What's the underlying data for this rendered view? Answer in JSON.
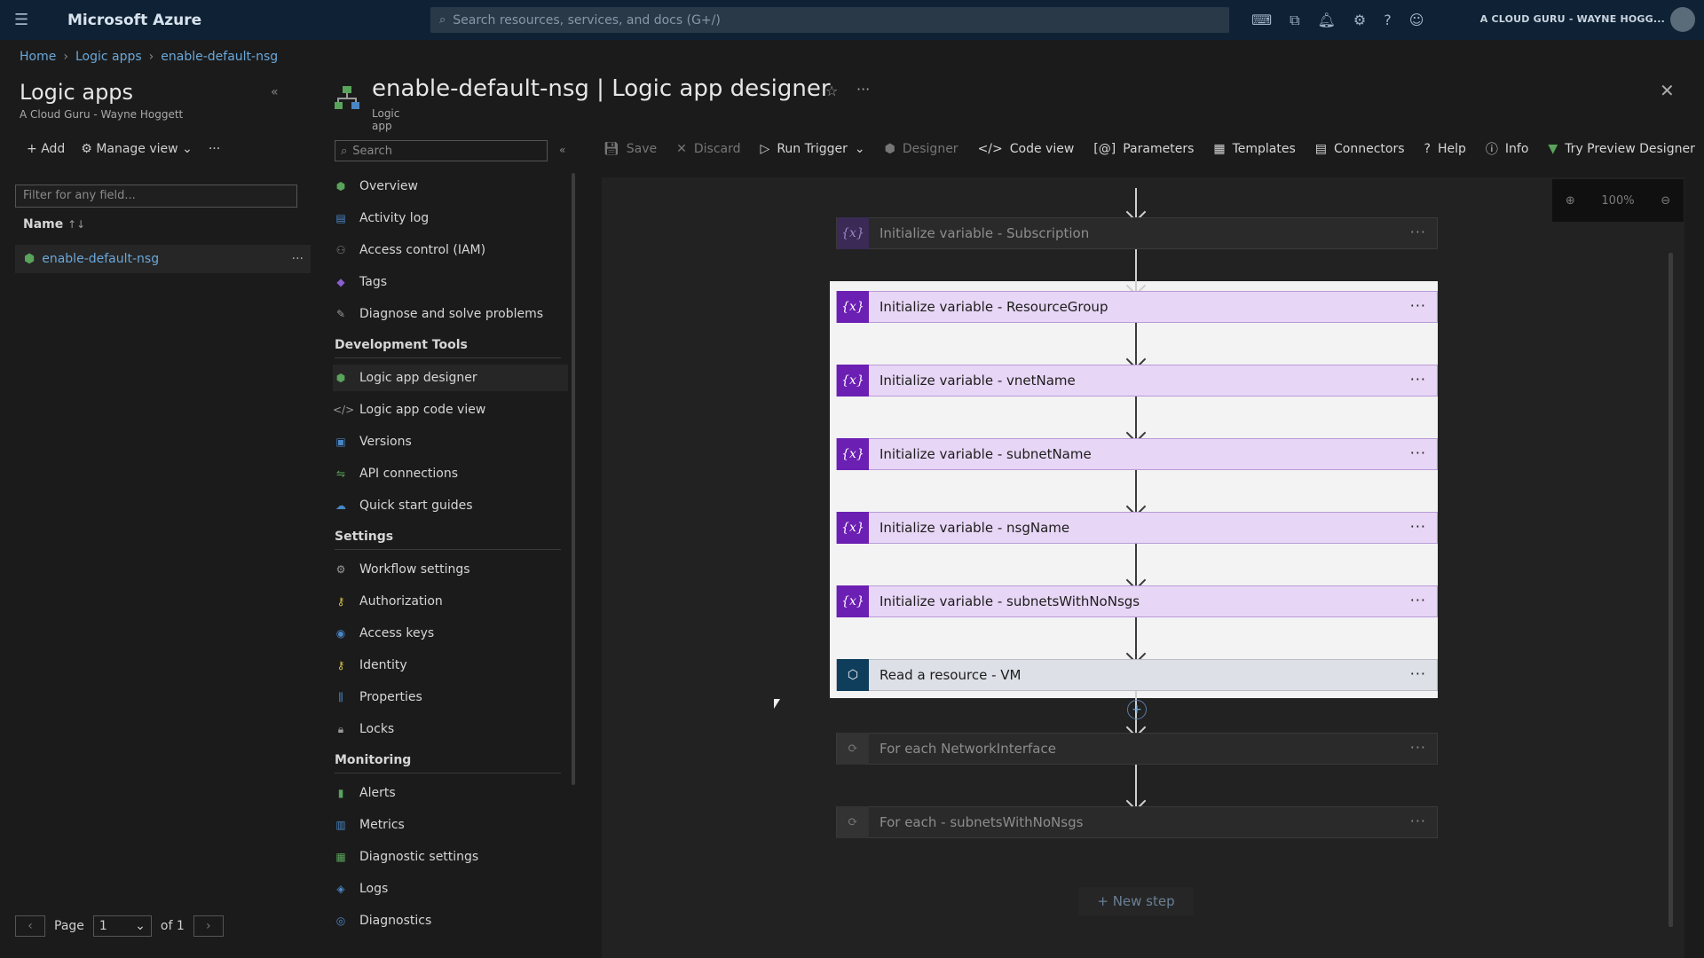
{
  "portal": {
    "menu_icon": "hamburger-icon",
    "brand": "Microsoft Azure",
    "search_placeholder": "Search resources, services, and docs (G+/)",
    "account": "A CLOUD GURU - WAYNE HOGG..."
  },
  "breadcrumb": [
    "Home",
    "Logic apps",
    "enable-default-nsg"
  ],
  "left_pane": {
    "title": "Logic apps",
    "subtitle": "A Cloud Guru - Wayne Hoggett",
    "add_label": "Add",
    "manage_view_label": "Manage view",
    "filter_placeholder": "Filter for any field...",
    "column_name": "Name",
    "sort_indicator": "↑↓",
    "rows": [
      {
        "name": "enable-default-nsg"
      }
    ],
    "pager": {
      "page_label": "Page",
      "page_value": "1",
      "of_label": "of 1"
    }
  },
  "resource": {
    "title": "enable-default-nsg | Logic app designer",
    "subtitle": "Logic app"
  },
  "nav": {
    "search_placeholder": "Search",
    "items_top": [
      {
        "label": "Overview",
        "icon": "overview-icon",
        "glyph": "⬢",
        "color": "#59a35b"
      },
      {
        "label": "Activity log",
        "icon": "activity-log-icon",
        "glyph": "▤",
        "color": "#4a86c5"
      },
      {
        "label": "Access control (IAM)",
        "icon": "iam-icon",
        "glyph": "⚇",
        "color": "#8a8a8a"
      },
      {
        "label": "Tags",
        "icon": "tag-icon",
        "glyph": "◆",
        "color": "#8a5fd1"
      },
      {
        "label": "Diagnose and solve problems",
        "icon": "wrench-icon",
        "glyph": "✎",
        "color": "#9a9a9a"
      }
    ],
    "section_dev": "Development Tools",
    "items_dev": [
      {
        "label": "Logic app designer",
        "icon": "designer-icon",
        "glyph": "⬢",
        "color": "#59a35b"
      },
      {
        "label": "Logic app code view",
        "icon": "code-view-icon",
        "glyph": "</>",
        "color": "#9a9a9a"
      },
      {
        "label": "Versions",
        "icon": "versions-icon",
        "glyph": "▣",
        "color": "#4a86c5"
      },
      {
        "label": "API connections",
        "icon": "api-connections-icon",
        "glyph": "⇋",
        "color": "#59a35b"
      },
      {
        "label": "Quick start guides",
        "icon": "quickstart-icon",
        "glyph": "☁",
        "color": "#4a86c5"
      }
    ],
    "section_settings": "Settings",
    "items_settings": [
      {
        "label": "Workflow settings",
        "icon": "gear-icon",
        "glyph": "⚙",
        "color": "#9a9a9a"
      },
      {
        "label": "Authorization",
        "icon": "key-icon",
        "glyph": "⚷",
        "color": "#d8c24a"
      },
      {
        "label": "Access keys",
        "icon": "access-keys-icon",
        "glyph": "◉",
        "color": "#4a86c5"
      },
      {
        "label": "Identity",
        "icon": "identity-icon",
        "glyph": "⚷",
        "color": "#d8c24a"
      },
      {
        "label": "Properties",
        "icon": "properties-icon",
        "glyph": "⫼",
        "color": "#4a86c5"
      },
      {
        "label": "Locks",
        "icon": "lock-icon",
        "glyph": "🔒︎",
        "color": "#9a9a9a"
      }
    ],
    "section_monitoring": "Monitoring",
    "items_monitoring": [
      {
        "label": "Alerts",
        "icon": "alerts-icon",
        "glyph": "▮",
        "color": "#59a35b"
      },
      {
        "label": "Metrics",
        "icon": "metrics-icon",
        "glyph": "▥",
        "color": "#4a86c5"
      },
      {
        "label": "Diagnostic settings",
        "icon": "diagnostic-settings-icon",
        "glyph": "▦",
        "color": "#59a35b"
      },
      {
        "label": "Logs",
        "icon": "logs-icon",
        "glyph": "◈",
        "color": "#4a86c5"
      },
      {
        "label": "Diagnostics",
        "icon": "diagnostics-icon",
        "glyph": "◎",
        "color": "#4a86c5"
      }
    ]
  },
  "toolbar": [
    {
      "label": "Save",
      "icon": "save-icon",
      "glyph": "💾︎",
      "enabled": false
    },
    {
      "label": "Discard",
      "icon": "discard-icon",
      "glyph": "✕",
      "enabled": false
    },
    {
      "label": "Run Trigger",
      "icon": "run-trigger-icon",
      "glyph": "▷",
      "enabled": true,
      "dropdown": true
    },
    {
      "label": "Designer",
      "icon": "designer-icon",
      "glyph": "⬢",
      "enabled": false
    },
    {
      "label": "Code view",
      "icon": "code-view-icon",
      "glyph": "</>",
      "enabled": true
    },
    {
      "label": "Parameters",
      "icon": "parameters-icon",
      "glyph": "[@]",
      "enabled": true
    },
    {
      "label": "Templates",
      "icon": "templates-icon",
      "glyph": "▦",
      "enabled": true
    },
    {
      "label": "Connectors",
      "icon": "connectors-icon",
      "glyph": "▤",
      "enabled": true
    },
    {
      "label": "Help",
      "icon": "help-icon",
      "glyph": "?",
      "enabled": true
    },
    {
      "label": "Info",
      "icon": "info-icon",
      "glyph": "ⓘ",
      "enabled": true
    },
    {
      "label": "Try Preview Designer",
      "icon": "preview-icon",
      "glyph": "▼",
      "enabled": true
    }
  ],
  "zoom": {
    "level": "100%"
  },
  "steps": [
    {
      "label": "Initialize variable - Subscription",
      "kind": "variable",
      "highlighted": false
    },
    {
      "label": "Initialize variable - ResourceGroup",
      "kind": "variable",
      "highlighted": true
    },
    {
      "label": "Initialize variable - vnetName",
      "kind": "variable",
      "highlighted": true
    },
    {
      "label": "Initialize variable - subnetName",
      "kind": "variable",
      "highlighted": true
    },
    {
      "label": "Initialize variable - nsgName",
      "kind": "variable",
      "highlighted": true
    },
    {
      "label": "Initialize variable - subnetsWithNoNsgs",
      "kind": "variable",
      "highlighted": true
    },
    {
      "label": "Read a resource - VM",
      "kind": "resource",
      "highlighted": true
    },
    {
      "label": "For each NetworkInterface",
      "kind": "loop",
      "highlighted": false
    },
    {
      "label": "For each - subnetsWithNoNsgs",
      "kind": "loop",
      "highlighted": false
    }
  ],
  "new_step": "+ New step",
  "step_glyphs": {
    "variable": "{x}",
    "resource": "⬡",
    "loop": "⟳",
    "more": "···"
  }
}
